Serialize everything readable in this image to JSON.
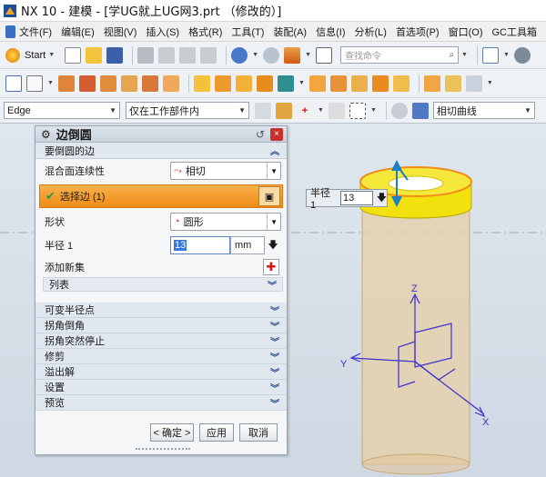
{
  "window": {
    "title": "NX 10 - 建模 - [学UG就上UG网3.prt （修改的）]"
  },
  "menu": {
    "items": [
      "文件(F)",
      "编辑(E)",
      "视图(V)",
      "插入(S)",
      "格式(R)",
      "工具(T)",
      "装配(A)",
      "信息(I)",
      "分析(L)"
    ],
    "search_placeholder": "查找命令",
    "right_items": [
      "首选项(P)",
      "窗口(O)",
      "GC工具箱"
    ]
  },
  "toolbar": {
    "start_label": "Start",
    "filter_edge": "Edge",
    "filter_scope": "仅在工作部件内",
    "curve_rule": "相切曲线"
  },
  "dialog": {
    "title": "边倒圆",
    "section_edge": "要倒圆的边",
    "continuity_label": "混合面连续性",
    "continuity_value": "相切",
    "select_edge_label": "选择边 (1)",
    "shape_label": "形状",
    "shape_value": "圆形",
    "radius_label": "半径 1",
    "radius_value": "13",
    "radius_unit": "mm",
    "add_set_label": "添加新集",
    "list_label": "列表",
    "collapsed": [
      "可变半径点",
      "拐角倒角",
      "拐角突然停止",
      "修剪",
      "溢出解",
      "设置",
      "预览"
    ],
    "ok_label": "< 确定 >",
    "apply_label": "应用",
    "cancel_label": "取消"
  },
  "viewport": {
    "radius_label": "半径 1",
    "radius_value": "13",
    "axis_x": "X",
    "axis_y": "Y",
    "axis_z": "Z"
  },
  "colors": {
    "cylinder": "#e7cfa6",
    "cap": "#f2e10e",
    "edge_highlight": "#f08c1b",
    "csys": "#3d2fd0",
    "dialog_select": "#f08b17"
  }
}
